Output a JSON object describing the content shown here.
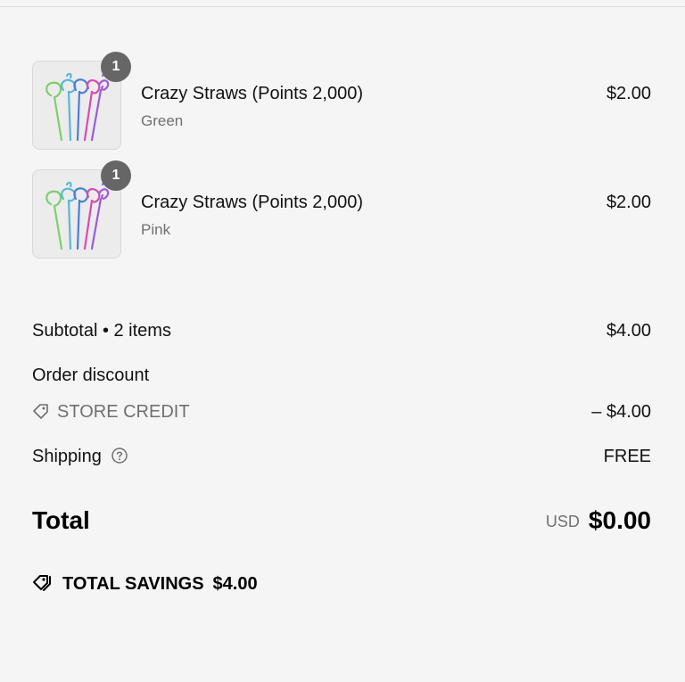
{
  "items": [
    {
      "title": "Crazy Straws (Points 2,000)",
      "variant": "Green",
      "price": "$2.00",
      "quantity": "1",
      "icon": "crazy-straws-image"
    },
    {
      "title": "Crazy Straws (Points 2,000)",
      "variant": "Pink",
      "price": "$2.00",
      "quantity": "1",
      "icon": "crazy-straws-image"
    }
  ],
  "summary": {
    "subtotal_label": "Subtotal • 2 items",
    "subtotal_value": "$4.00",
    "discount_label": "Order discount",
    "discount_code": "STORE CREDIT",
    "discount_value": "– $4.00",
    "shipping_label": "Shipping",
    "shipping_value": "FREE"
  },
  "total": {
    "label": "Total",
    "currency": "USD",
    "amount": "$0.00"
  },
  "savings": {
    "label": "TOTAL SAVINGS",
    "amount": "$4.00"
  },
  "colors": {
    "background": "#f5f5f5",
    "badge": "#666666",
    "muted_text": "#707070"
  }
}
